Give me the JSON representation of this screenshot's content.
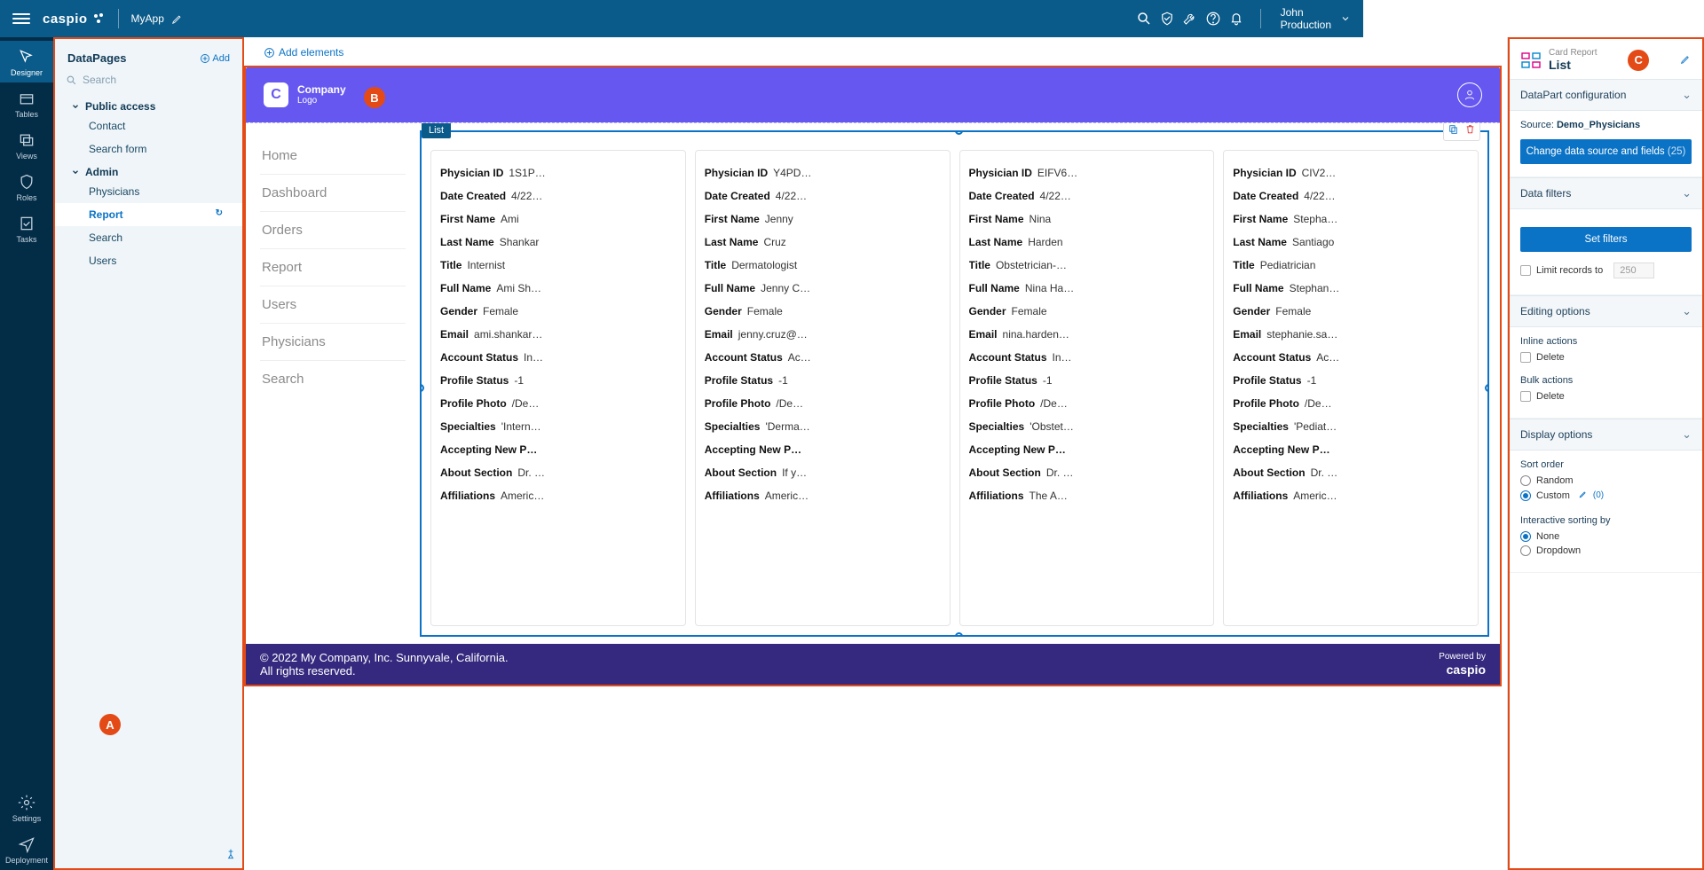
{
  "topbar": {
    "logo": "caspio",
    "app_name": "MyApp",
    "user_name": "John",
    "user_env": "Production"
  },
  "rail": [
    {
      "label": "Designer",
      "icon": "cursor"
    },
    {
      "label": "Tables",
      "icon": "table"
    },
    {
      "label": "Views",
      "icon": "views"
    },
    {
      "label": "Roles",
      "icon": "shield"
    },
    {
      "label": "Tasks",
      "icon": "check"
    },
    {
      "label": "Settings",
      "icon": "gear"
    },
    {
      "label": "Deployment",
      "icon": "send"
    }
  ],
  "tree": {
    "title": "DataPages",
    "add_label": "Add",
    "search_placeholder": "Search",
    "groups": [
      {
        "label": "Public access",
        "items": [
          "Contact",
          "Search form"
        ]
      },
      {
        "label": "Admin",
        "items": [
          "Physicians",
          "Report",
          "Search",
          "Users"
        ],
        "selected": "Report"
      }
    ]
  },
  "canvas": {
    "add_elements": "Add elements",
    "company": "Company",
    "company_sub": "Logo",
    "nav": [
      "Home",
      "Dashboard",
      "Orders",
      "Report",
      "Users",
      "Physicians",
      "Search"
    ],
    "list_label": "List",
    "fields": [
      "Physician ID",
      "Date Created",
      "First Name",
      "Last Name",
      "Title",
      "Full Name",
      "Gender",
      "Email",
      "Account Status",
      "Profile Status",
      "Profile Photo",
      "Specialties",
      "Accepting New P…",
      "About Section",
      "Affiliations"
    ],
    "cards": [
      {
        "vals": [
          "1S1P…",
          "4/22…",
          "Ami",
          "Shankar",
          "Internist",
          "Ami Sh…",
          "Female",
          "ami.shankar…",
          "In…",
          "-1",
          "/De…",
          "'Intern…",
          "",
          "Dr. …",
          "Americ…"
        ]
      },
      {
        "vals": [
          "Y4PD…",
          "4/22…",
          "Jenny",
          "Cruz",
          "Dermatologist",
          "Jenny C…",
          "Female",
          "jenny.cruz@…",
          "Ac…",
          "-1",
          "/De…",
          "'Derma…",
          "",
          "If y…",
          "Americ…"
        ]
      },
      {
        "vals": [
          "EIFV6…",
          "4/22…",
          "Nina",
          "Harden",
          "Obstetrician-…",
          "Nina Ha…",
          "Female",
          "nina.harden…",
          "In…",
          "-1",
          "/De…",
          "'Obstet…",
          "",
          "Dr. …",
          "The A…"
        ]
      },
      {
        "vals": [
          "CIV2…",
          "4/22…",
          "Stepha…",
          "Santiago",
          "Pediatrician",
          "Stephan…",
          "Female",
          "stephanie.sa…",
          "Ac…",
          "-1",
          "/De…",
          "'Pediat…",
          "",
          "Dr. …",
          "Americ…"
        ]
      }
    ],
    "footer_line1": "© 2022 My Company, Inc. Sunnyvale, California.",
    "footer_line2": "All rights reserved.",
    "powered_label": "Powered by",
    "powered_brand": "caspio"
  },
  "props": {
    "type_label": "Card Report",
    "title": "List",
    "sections": {
      "config_header": "DataPart configuration",
      "source_label": "Source:",
      "source_value": "Demo_Physicians",
      "change_ds_btn": "Change data source and fields",
      "change_ds_count": "(25)",
      "filters_header": "Data filters",
      "set_filters_btn": "Set filters",
      "limit_label": "Limit records to",
      "limit_value": "250",
      "editing_header": "Editing options",
      "inline_label": "Inline actions",
      "delete_label": "Delete",
      "bulk_label": "Bulk actions",
      "display_header": "Display options",
      "sort_order_label": "Sort order",
      "random_label": "Random",
      "custom_label": "Custom",
      "custom_count": "(0)",
      "interactive_label": "Interactive sorting by",
      "none_label": "None",
      "dropdown_label": "Dropdown"
    }
  },
  "callouts": {
    "a": "A",
    "b": "B",
    "c": "C"
  }
}
